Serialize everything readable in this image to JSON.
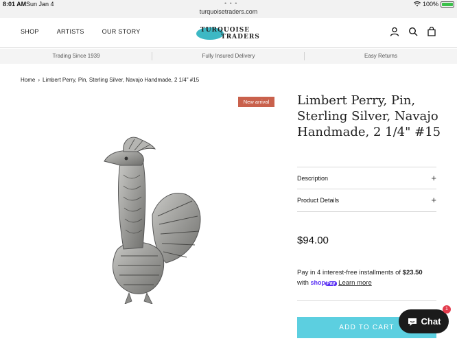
{
  "status_bar": {
    "time": "8:01 AM",
    "date": "Sun Jan 4",
    "url": "turquoisetraders.com",
    "battery": "100%"
  },
  "header": {
    "nav": [
      "SHOP",
      "ARTISTS",
      "OUR STORY"
    ],
    "logo_line1": "TURQUOISE",
    "logo_line2": "TRADERS",
    "brand_color": "#3db8c4"
  },
  "promo": [
    "Trading Since 1939",
    "Fully Insured Delivery",
    "Easy Returns"
  ],
  "breadcrumb": {
    "home": "Home",
    "separator": "›",
    "current": "Limbert Perry, Pin, Sterling Silver, Navajo Handmade, 2 1/4\" #15"
  },
  "product": {
    "badge": "New arrival",
    "title": "Limbert Perry, Pin, Sterling Silver, Navajo Handmade, 2 1/4\" #15",
    "accordions": [
      "Description",
      "Product Details"
    ],
    "price": "$94.00",
    "installments_prefix": "Pay in 4 interest-free installments of ",
    "installment_amount": "$23.50",
    "installments_with": "with ",
    "shop_label": "shop",
    "pay_label": "Pay",
    "learn_more": "Learn more",
    "add_to_cart": "ADD TO CART",
    "cart_color": "#5ccfe0",
    "badge_color": "#c9614c"
  },
  "chat": {
    "label": "Chat",
    "badge_count": "1"
  }
}
